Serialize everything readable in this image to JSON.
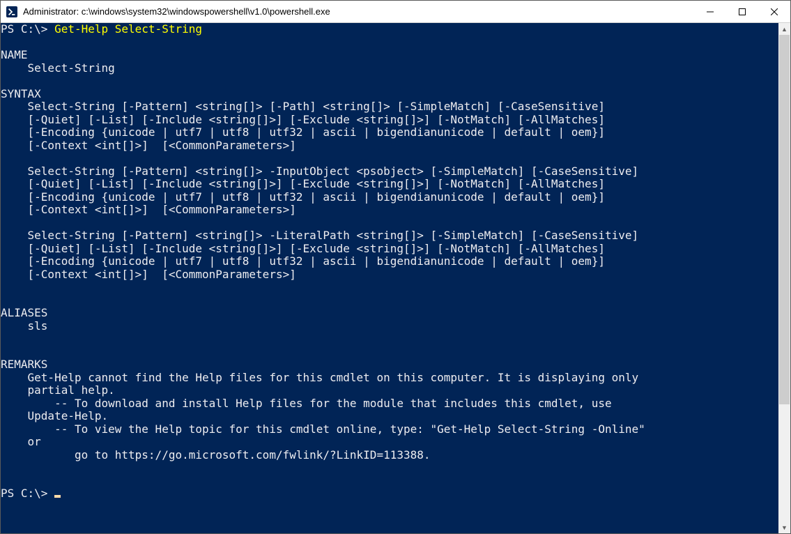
{
  "window": {
    "title": "Administrator: c:\\windows\\system32\\windowspowershell\\v1.0\\powershell.exe"
  },
  "colors": {
    "console_bg": "#012456",
    "console_fg": "#eeedf0",
    "command_fg": "#ffff00"
  },
  "prompt1": {
    "prefix": "PS C:\\> ",
    "command": "Get-Help Select-String"
  },
  "help": {
    "name_header": "NAME",
    "name_value": "    Select-String",
    "syntax_header": "SYNTAX",
    "syntax1_l1": "    Select-String [-Pattern] <string[]> [-Path] <string[]> [-SimpleMatch] [-CaseSensitive]",
    "syntax1_l2": "    [-Quiet] [-List] [-Include <string[]>] [-Exclude <string[]>] [-NotMatch] [-AllMatches]",
    "syntax1_l3": "    [-Encoding {unicode | utf7 | utf8 | utf32 | ascii | bigendianunicode | default | oem}]",
    "syntax1_l4": "    [-Context <int[]>]  [<CommonParameters>]",
    "syntax2_l1": "    Select-String [-Pattern] <string[]> -InputObject <psobject> [-SimpleMatch] [-CaseSensitive]",
    "syntax2_l2": "    [-Quiet] [-List] [-Include <string[]>] [-Exclude <string[]>] [-NotMatch] [-AllMatches]",
    "syntax2_l3": "    [-Encoding {unicode | utf7 | utf8 | utf32 | ascii | bigendianunicode | default | oem}]",
    "syntax2_l4": "    [-Context <int[]>]  [<CommonParameters>]",
    "syntax3_l1": "    Select-String [-Pattern] <string[]> -LiteralPath <string[]> [-SimpleMatch] [-CaseSensitive]",
    "syntax3_l2": "    [-Quiet] [-List] [-Include <string[]>] [-Exclude <string[]>] [-NotMatch] [-AllMatches]",
    "syntax3_l3": "    [-Encoding {unicode | utf7 | utf8 | utf32 | ascii | bigendianunicode | default | oem}]",
    "syntax3_l4": "    [-Context <int[]>]  [<CommonParameters>]",
    "aliases_header": "ALIASES",
    "aliases_value": "    sls",
    "remarks_header": "REMARKS",
    "remarks_l1": "    Get-Help cannot find the Help files for this cmdlet on this computer. It is displaying only",
    "remarks_l2": "    partial help.",
    "remarks_l3": "        -- To download and install Help files for the module that includes this cmdlet, use",
    "remarks_l4": "    Update-Help.",
    "remarks_l5": "        -- To view the Help topic for this cmdlet online, type: \"Get-Help Select-String -Online\"",
    "remarks_l6": "    or",
    "remarks_l7": "           go to https://go.microsoft.com/fwlink/?LinkID=113388."
  },
  "prompt2": {
    "prefix": "PS C:\\> "
  },
  "scrollbar": {
    "thumb_top_pct": 0,
    "thumb_height_pct": 76
  }
}
